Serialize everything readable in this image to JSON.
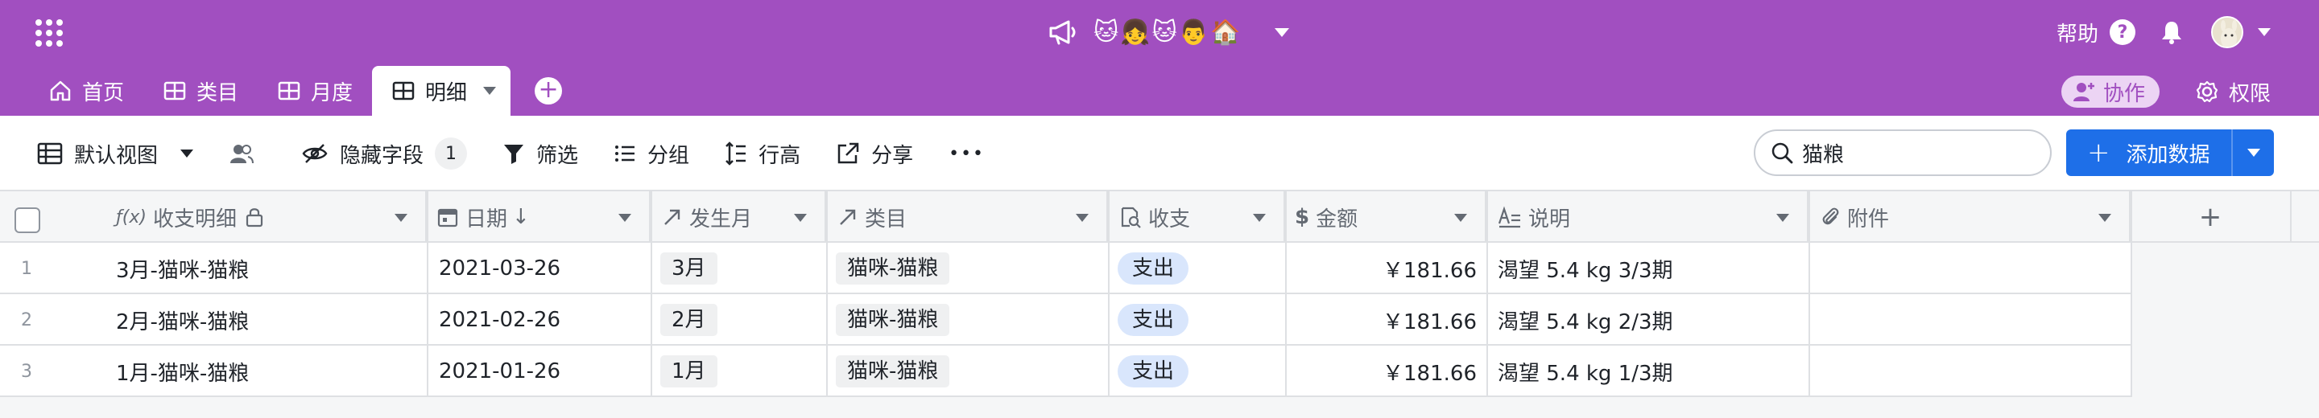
{
  "header": {
    "title": "🐱👧🐱👨🏠",
    "help_label": "帮助",
    "help_icon_text": "?"
  },
  "tabs": [
    {
      "label": "首页",
      "icon": "home-icon"
    },
    {
      "label": "类目",
      "icon": "grid-table-icon"
    },
    {
      "label": "月度",
      "icon": "grid-table-icon"
    },
    {
      "label": "明细",
      "icon": "grid-table-icon",
      "active": true
    }
  ],
  "tab_actions": {
    "add_label": "+",
    "collab_label": "协作",
    "permission_label": "权限"
  },
  "toolbar": {
    "view_label": "默认视图",
    "hidden_fields_label": "隐藏字段",
    "hidden_fields_count": "1",
    "filter_label": "筛选",
    "group_label": "分组",
    "row_height_label": "行高",
    "share_label": "分享",
    "more_label": "•••",
    "search_value": "猫粮",
    "add_data_label": "添加数据"
  },
  "table": {
    "add_column_label": "+",
    "columns": [
      {
        "label": "收支明细",
        "icon": "formula-icon"
      },
      {
        "label": "日期",
        "icon": "calendar-icon"
      },
      {
        "label": "发生月",
        "icon": "lookup-arrow-icon"
      },
      {
        "label": "类目",
        "icon": "lookup-arrow-icon"
      },
      {
        "label": "收支",
        "icon": "single-select-icon"
      },
      {
        "label": "金额",
        "icon": "currency-icon"
      },
      {
        "label": "说明",
        "icon": "text-icon"
      },
      {
        "label": "附件",
        "icon": "attachment-icon"
      }
    ],
    "rows": [
      {
        "num": "1",
        "detail": "3月-猫咪-猫粮",
        "date": "2021-03-26",
        "month": "3月",
        "category": "猫咪-猫粮",
        "type": "支出",
        "amount": "￥181.66",
        "note": "渴望 5.4 kg 3/3期"
      },
      {
        "num": "2",
        "detail": "2月-猫咪-猫粮",
        "date": "2021-02-26",
        "month": "2月",
        "category": "猫咪-猫粮",
        "type": "支出",
        "amount": "￥181.66",
        "note": "渴望 5.4 kg 2/3期"
      },
      {
        "num": "3",
        "detail": "1月-猫咪-猫粮",
        "date": "2021-01-26",
        "month": "1月",
        "category": "猫咪-猫粮",
        "type": "支出",
        "amount": "￥181.66",
        "note": "渴望 5.4 kg 1/3期"
      }
    ]
  },
  "colors": {
    "brand_purple": "#a14fc0",
    "primary_blue": "#1e6fe8",
    "tag_blue": "#d9e6fc"
  }
}
